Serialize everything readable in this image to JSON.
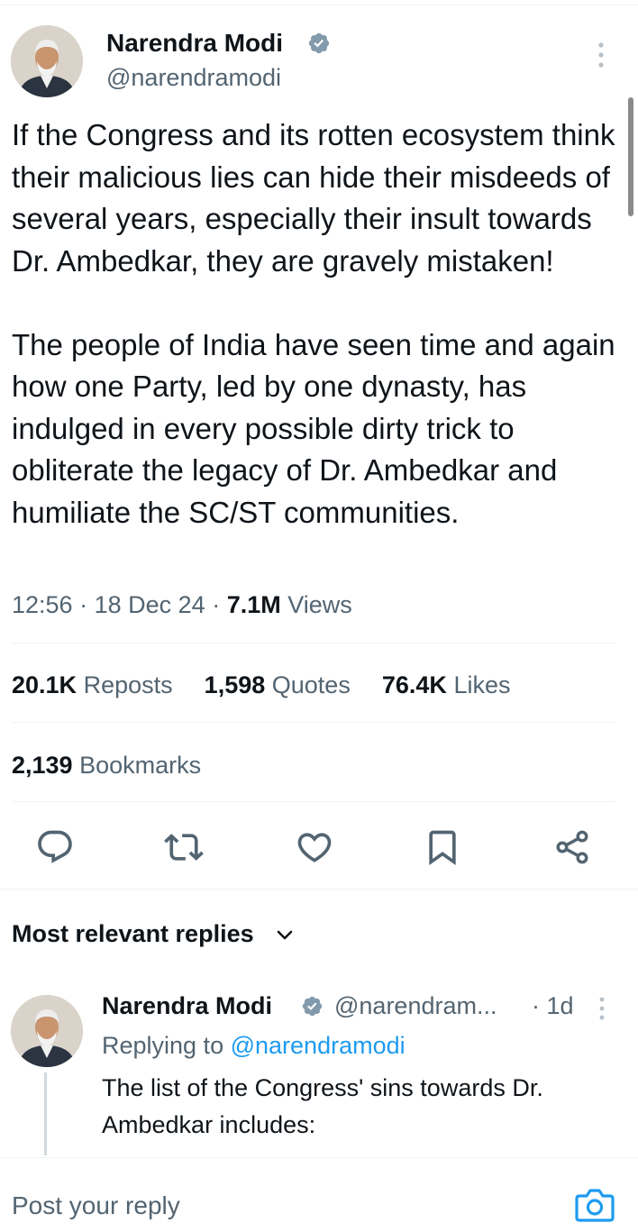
{
  "tweet": {
    "author_name": "Narendra Modi",
    "author_handle": "@narendramodi",
    "text": "If the Congress and its rotten ecosystem think their malicious lies can hide their misdeeds of several years, especially their insult towards Dr. Ambedkar, they are gravely mistaken!\n\nThe people of India have seen time and again how one Party, led by one dynasty, has indulged in every possible dirty trick to obliterate the legacy of Dr. Ambedkar and humiliate the SC/ST communities.",
    "time": "12:56",
    "date": "18 Dec 24",
    "views_count": "7.1M",
    "views_label": "Views"
  },
  "stats": {
    "reposts_count": "20.1K",
    "reposts_label": "Reposts",
    "quotes_count": "1,598",
    "quotes_label": "Quotes",
    "likes_count": "76.4K",
    "likes_label": "Likes",
    "bookmarks_count": "2,139",
    "bookmarks_label": "Bookmarks"
  },
  "actions": [
    "reply-icon",
    "repost-icon",
    "like-icon",
    "bookmark-icon",
    "share-icon"
  ],
  "replies": {
    "sort_label": "Most relevant replies",
    "first": {
      "author_name": "Narendra Modi",
      "author_handle": "@narendram...",
      "time": "1d",
      "replying_prefix": "Replying to",
      "replying_to": "@narendramodi",
      "text": "The list of the Congress' sins towards Dr.\nAmbedkar includes:"
    }
  },
  "composer": {
    "placeholder": "Post your reply"
  },
  "colors": {
    "primary_text": "#0f1419",
    "secondary_text": "#536471",
    "accent": "#1d9bf0",
    "verified_badge": "#829aab",
    "divider": "#eff3f4"
  }
}
